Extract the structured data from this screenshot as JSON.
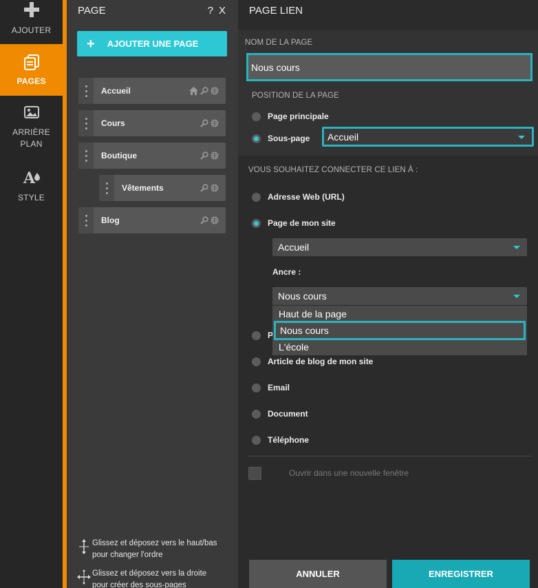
{
  "rail": {
    "items": [
      {
        "label": "AJOUTER",
        "icon": "plus-icon"
      },
      {
        "label": "PAGES",
        "icon": "pages-icon"
      },
      {
        "label_line1": "ARRIÈRE",
        "label_line2": "PLAN",
        "icon": "image-icon"
      },
      {
        "label": "STYLE",
        "icon": "style-icon"
      }
    ],
    "active_color": "#f08a00"
  },
  "page_panel": {
    "title": "PAGE",
    "help": "?",
    "close": "X",
    "add_button": "AJOUTER UNE PAGE",
    "pages": [
      {
        "name": "Accueil",
        "home": true,
        "sub": false
      },
      {
        "name": "Cours",
        "home": false,
        "sub": false
      },
      {
        "name": "Boutique",
        "home": false,
        "sub": false
      },
      {
        "name": "Vêtements",
        "home": false,
        "sub": true
      },
      {
        "name": "Blog",
        "home": false,
        "sub": false
      }
    ],
    "hint_reorder_1": "Glissez et déposez vers le haut/bas",
    "hint_reorder_2": "pour changer l'ordre",
    "hint_sub_1": "Glissez et déposez vers la droite",
    "hint_sub_2": "pour créer des sous-pages"
  },
  "form": {
    "title": "PAGE LIEN",
    "name_caption": "NOM DE LA PAGE",
    "name_value": "Nous cours",
    "position_caption": "POSITION DE LA PAGE",
    "position_main": "Page principale",
    "position_sub": "Sous-page",
    "parent_select": "Accueil",
    "connect_caption": "VOUS SOUHAITEZ CONNECTER CE LIEN À :",
    "link_types": {
      "url": "Adresse Web (URL)",
      "site_page": "Page de mon site",
      "hidden_p": "P",
      "blog": "Article de blog de mon site",
      "email": "Email",
      "document": "Document",
      "phone": "Téléphone"
    },
    "site_page_select": "Accueil",
    "anchor_label": "Ancre :",
    "anchor_select": "Nous cours",
    "anchor_options": [
      "Haut de la page",
      "Nous cours",
      "L'école"
    ],
    "new_window": "Ouvrir dans une nouvelle fenêtre",
    "cancel": "ANNULER",
    "save": "ENREGISTRER",
    "accent": "#2ec8d4"
  }
}
